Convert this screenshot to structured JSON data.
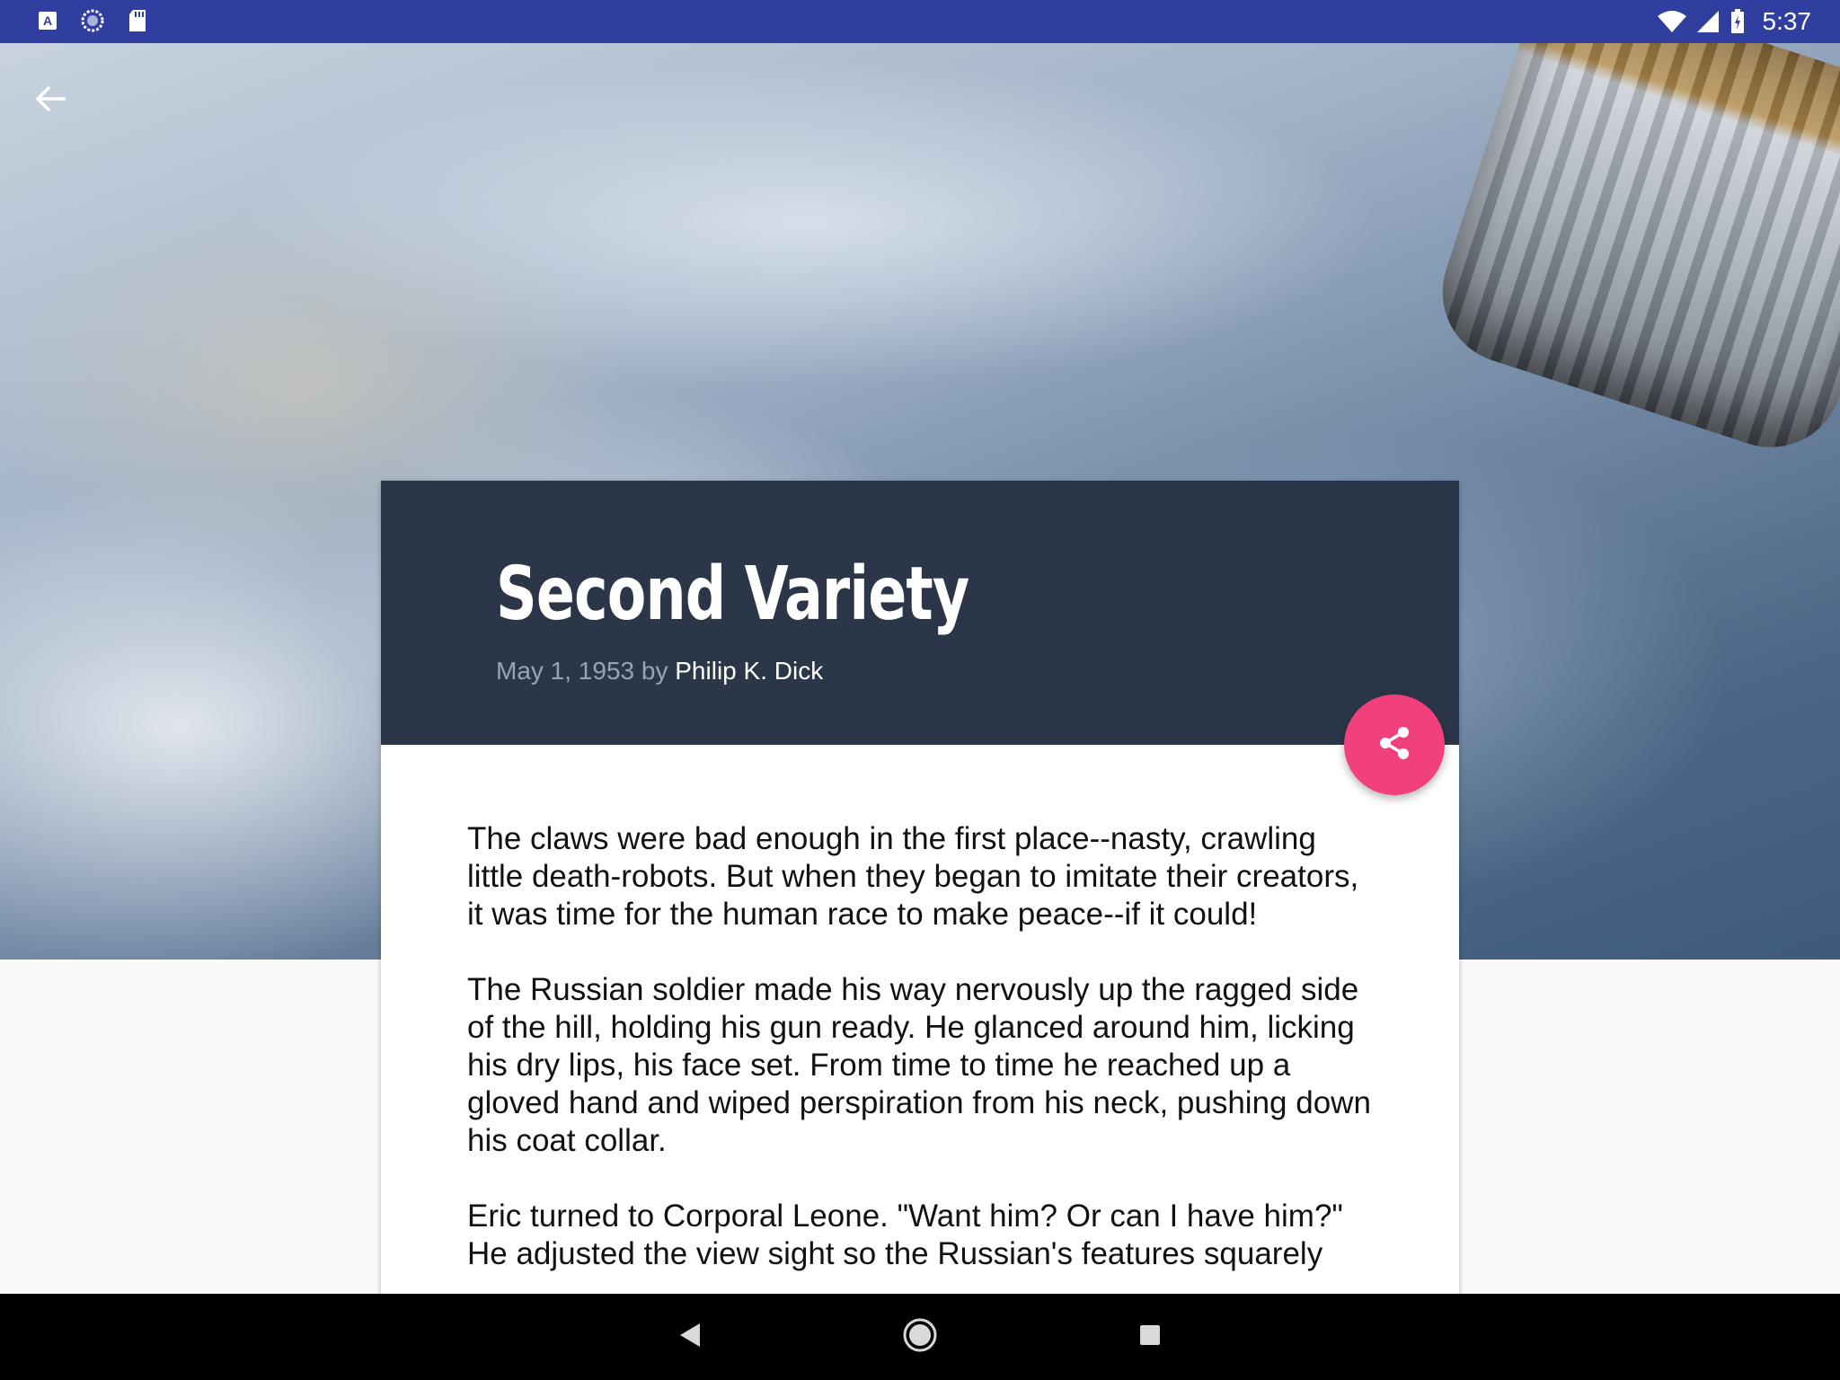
{
  "status_bar": {
    "time": "5:37",
    "left_icons": [
      "app-icon",
      "sync-icon",
      "sd-card-icon"
    ],
    "right_icons": [
      "wifi-icon",
      "signal-icon",
      "battery-icon"
    ]
  },
  "article": {
    "title": "Second Variety",
    "date": "May 1, 1953",
    "by": "by",
    "author": "Philip K. Dick",
    "paragraphs": [
      "The claws were bad enough in the first place--nasty, crawling little death-robots. But when they began to imitate their creators, it was time for the human race to make peace--if it could!",
      "The Russian soldier made his way nervously up the ragged side of the hill, holding his gun ready. He glanced around him, licking his dry lips, his face set. From time to time he reached up a gloved hand and wiped perspiration from his neck, pushing down his coat collar.",
      "Eric turned to Corporal Leone. \"Want him? Or can I have him?\" He adjusted the view sight so the Russian's features squarely"
    ]
  },
  "colors": {
    "status_bar": "#303f9f",
    "header": "#2b3648",
    "fab": "#f2407c"
  },
  "nav_bar": {
    "buttons": [
      "back-triangle-icon",
      "home-circle-icon",
      "recents-square-icon"
    ]
  }
}
